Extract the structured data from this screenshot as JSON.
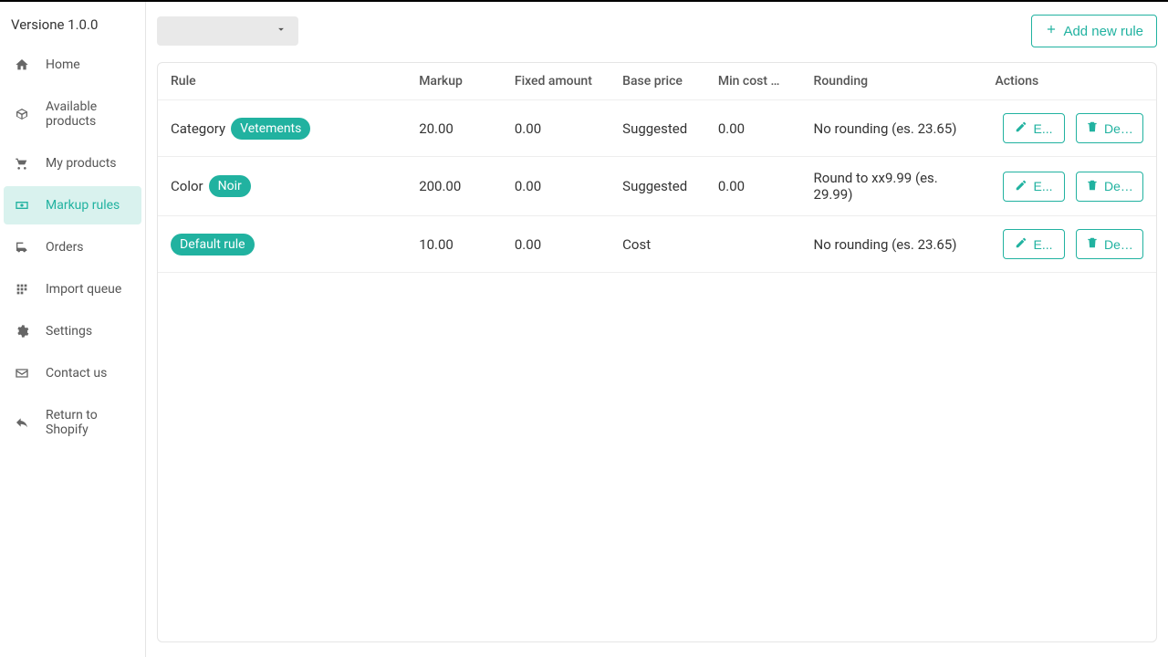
{
  "version": "Versione 1.0.0",
  "sidebar": {
    "items": [
      {
        "label": "Home",
        "icon": "home-icon",
        "active": false
      },
      {
        "label": "Available products",
        "icon": "box-icon",
        "active": false
      },
      {
        "label": "My products",
        "icon": "cart-icon",
        "active": false
      },
      {
        "label": "Markup rules",
        "icon": "money-icon",
        "active": true
      },
      {
        "label": "Orders",
        "icon": "truck-icon",
        "active": false
      },
      {
        "label": "Import queue",
        "icon": "grid-icon",
        "active": false
      },
      {
        "label": "Settings",
        "icon": "gear-icon",
        "active": false
      },
      {
        "label": "Contact us",
        "icon": "mail-icon",
        "active": false
      },
      {
        "label": "Return to Shopify",
        "icon": "reply-icon",
        "active": false
      }
    ]
  },
  "toolbar": {
    "add_label": "Add new rule"
  },
  "table": {
    "headers": {
      "rule": "Rule",
      "markup": "Markup",
      "fixed": "Fixed amount",
      "base": "Base price",
      "min": "Min cost mar...",
      "round": "Rounding",
      "actions": "Actions"
    },
    "rows": [
      {
        "prefix": "Category",
        "tag": "Vetements",
        "markup": "20.00",
        "fixed": "0.00",
        "base": "Suggested",
        "min": "0.00",
        "round": "No rounding (es. 23.65)"
      },
      {
        "prefix": "Color",
        "tag": "Noir",
        "markup": "200.00",
        "fixed": "0.00",
        "base": "Suggested",
        "min": "0.00",
        "round": "Round to xx9.99 (es. 29.99)"
      },
      {
        "prefix": "",
        "tag": "Default rule",
        "markup": "10.00",
        "fixed": "0.00",
        "base": "Cost",
        "min": "",
        "round": "No rounding (es. 23.65)"
      }
    ],
    "edit_label": "E...",
    "delete_label": "Del..."
  }
}
